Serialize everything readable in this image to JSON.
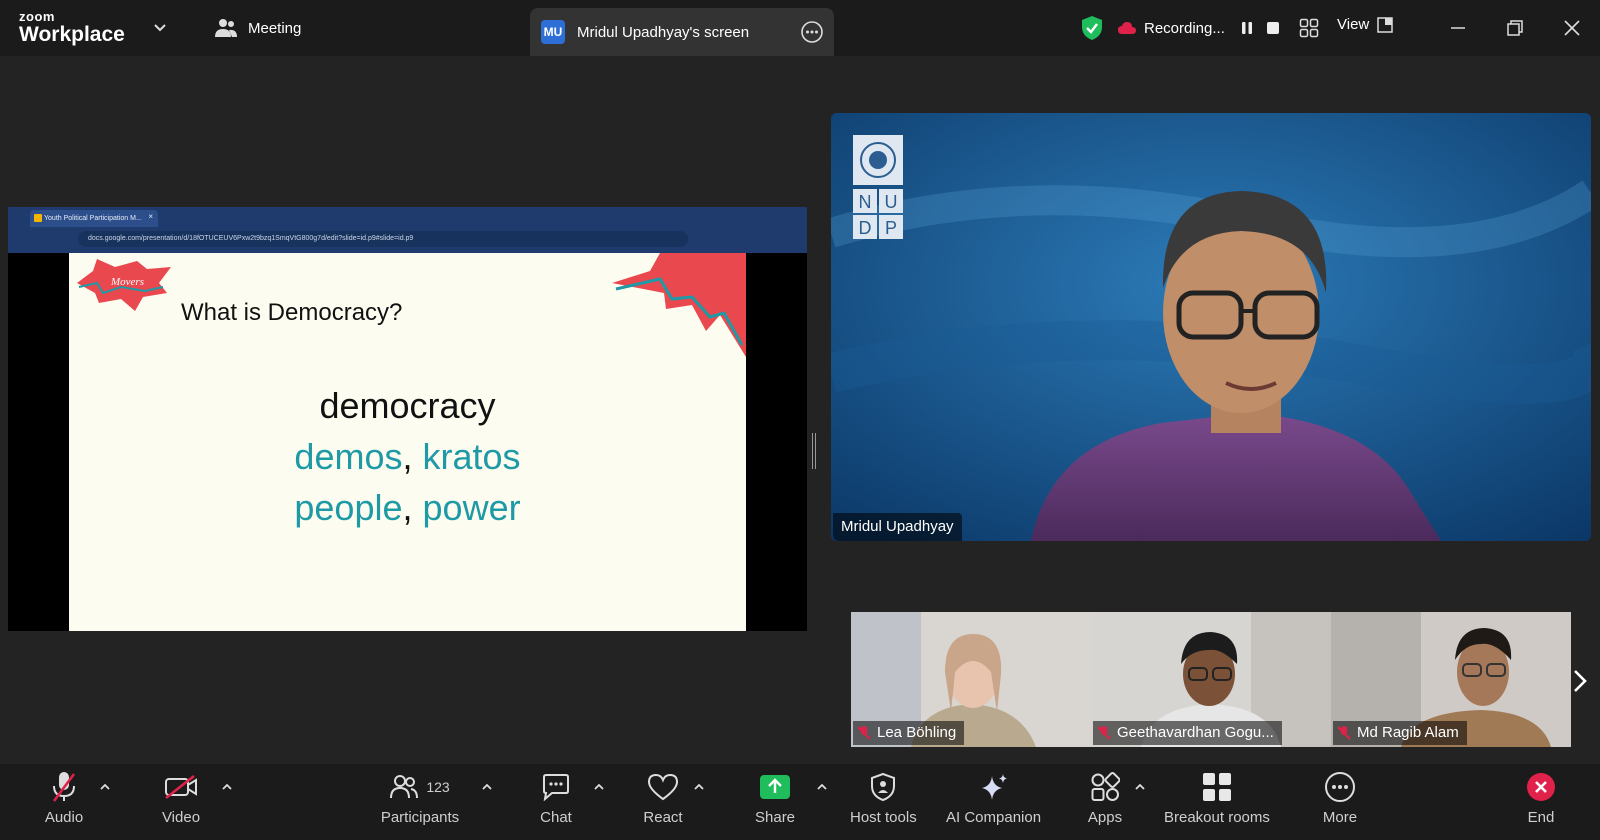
{
  "app": {
    "logo_small": "zoom",
    "logo_big": "Workplace",
    "meeting_label": "Meeting"
  },
  "share_tab": {
    "initials": "MU",
    "label": "Mridul Upadhyay's screen"
  },
  "recording": {
    "label": "Recording..."
  },
  "view": {
    "label": "View"
  },
  "shared_screen": {
    "browser_tab_title": "Youth Political Participation M...",
    "address": "docs.google.com/presentation/d/18fOTUCEUV6Pxw2t9bzq1SmqVtG800g7d/edit?slide=id.p9#slide=id.p9",
    "slide_logo": "Movers",
    "slide_title": "What is Democracy?",
    "word1": "democracy",
    "word2a": "demos",
    "word2b": "kratos",
    "word3a": "people",
    "word3b": "power",
    "comma": ","
  },
  "speaker": {
    "name": "Mridul Upadhyay",
    "logo_letters": [
      "N",
      "U",
      "D",
      "P"
    ]
  },
  "participants": [
    {
      "name": "Lea Böhling"
    },
    {
      "name": "Geethavardhan Gogu..."
    },
    {
      "name": "Md Ragib Alam"
    }
  ],
  "toolbar": {
    "audio": "Audio",
    "video": "Video",
    "participants": "Participants",
    "participants_count": "123",
    "chat": "Chat",
    "react": "React",
    "share": "Share",
    "host_tools": "Host tools",
    "ai_companion": "AI Companion",
    "apps": "Apps",
    "breakout_rooms": "Breakout rooms",
    "more": "More",
    "end": "End"
  },
  "colors": {
    "accent_blue": "#2d6fd6",
    "share_green": "#1fbd5b",
    "end_red": "#e0224a",
    "slide_teal": "#1e9aa6",
    "shield_green": "#1fbd5b"
  }
}
